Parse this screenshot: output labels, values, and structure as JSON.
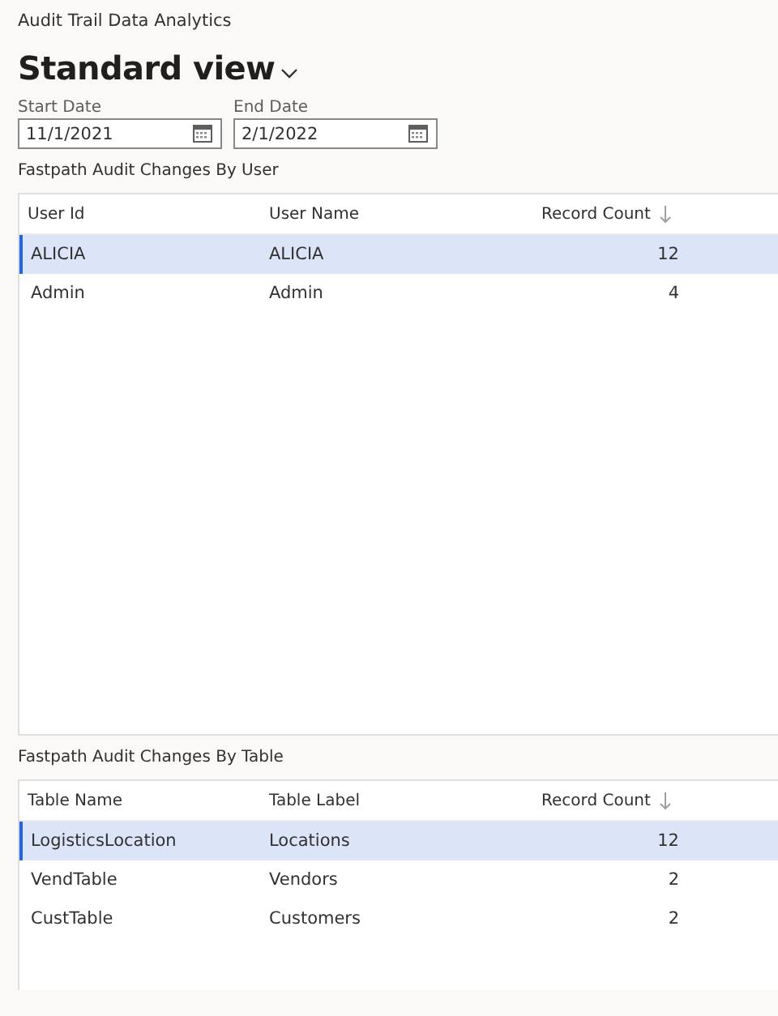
{
  "app_title": "Audit Trail Data Analytics",
  "view": {
    "title": "Standard view"
  },
  "filters": [
    {
      "label": "Start Date",
      "value": "11/1/2021"
    },
    {
      "label": "End Date",
      "value": "2/1/2022"
    }
  ],
  "grids": [
    {
      "title": "Fastpath Audit Changes By User",
      "columns": [
        {
          "label": "User Id",
          "sorted": false
        },
        {
          "label": "User Name",
          "sorted": false
        },
        {
          "label": "Record Count",
          "sorted": true
        }
      ],
      "rows": [
        {
          "cells": [
            "ALICIA",
            "ALICIA",
            "12"
          ],
          "selected": true
        },
        {
          "cells": [
            "Admin",
            "Admin",
            "4"
          ],
          "selected": false
        }
      ]
    },
    {
      "title": "Fastpath Audit Changes By Table",
      "columns": [
        {
          "label": "Table Name",
          "sorted": false
        },
        {
          "label": "Table Label",
          "sorted": false
        },
        {
          "label": "Record Count",
          "sorted": true
        }
      ],
      "rows": [
        {
          "cells": [
            "LogisticsLocation",
            "Locations",
            "12"
          ],
          "selected": true
        },
        {
          "cells": [
            "VendTable",
            "Vendors",
            "2"
          ],
          "selected": false
        },
        {
          "cells": [
            "CustTable",
            "Customers",
            "2"
          ],
          "selected": false
        }
      ]
    }
  ]
}
